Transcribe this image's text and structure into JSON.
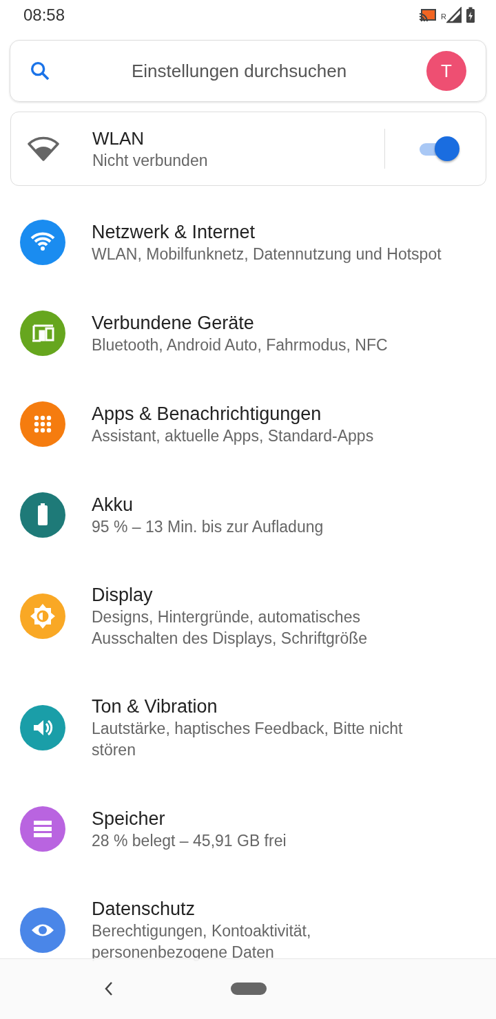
{
  "status_bar": {
    "time": "08:58",
    "roaming": "R"
  },
  "search": {
    "placeholder": "Einstellungen durchsuchen",
    "avatar": "T"
  },
  "wlan_card": {
    "title": "WLAN",
    "subtitle": "Nicht verbunden",
    "on": true
  },
  "items": [
    {
      "title": "Netzwerk & Internet",
      "subtitle": "WLAN, Mobilfunknetz, Datennutzung und Hotspot",
      "color": "#1a8cf0"
    },
    {
      "title": "Verbundene Geräte",
      "subtitle": "Bluetooth, Android Auto, Fahrmodus, NFC",
      "color": "#66a61e"
    },
    {
      "title": "Apps & Benachrichtigungen",
      "subtitle": "Assistant, aktuelle Apps, Standard-Apps",
      "color": "#f57c0f"
    },
    {
      "title": "Akku",
      "subtitle": "95 % – 13 Min. bis zur Aufladung",
      "color": "#1e7a78"
    },
    {
      "title": "Display",
      "subtitle": "Designs, Hintergründe, automatisches Ausschalten des Displays, Schriftgröße",
      "color": "#f9a825"
    },
    {
      "title": "Ton & Vibration",
      "subtitle": "Lautstärke, haptisches Feedback, Bitte nicht stören",
      "color": "#1a9ea8"
    },
    {
      "title": "Speicher",
      "subtitle": "28 % belegt – 45,91 GB frei",
      "color": "#b964e0"
    },
    {
      "title": "Datenschutz",
      "subtitle": "Berechtigungen, Kontoaktivität, personenbezogene Daten",
      "color": "#4a86e8"
    }
  ]
}
